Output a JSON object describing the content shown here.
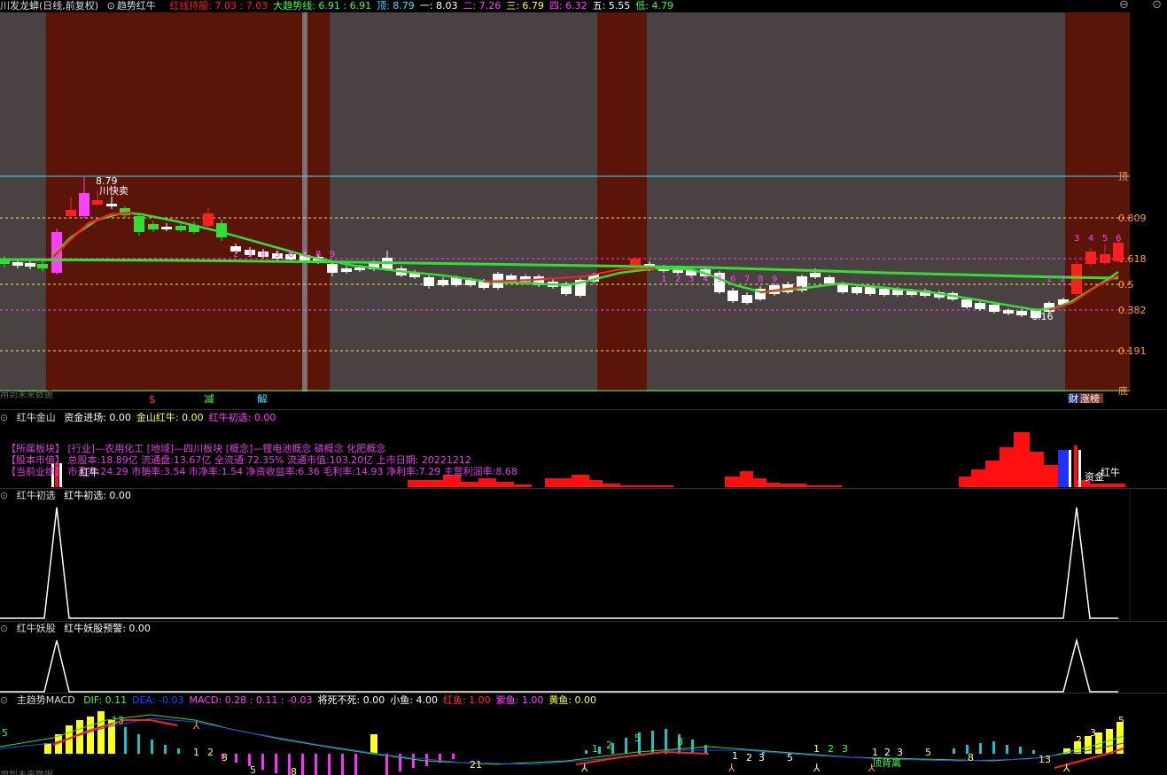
{
  "main": {
    "title": "川发龙蟒(日线,前复权)",
    "indicator_name": "趋势红牛",
    "items": [
      {
        "label": "红线持股: 7.03 : 7.03",
        "color": "#ff2020"
      },
      {
        "label": "大趋势线: 6.91 : 6.91",
        "color": "#40ff40"
      },
      {
        "label": "顶: 8.79",
        "color": "#40e0ff"
      },
      {
        "label": "一: 8.03",
        "color": "#ffffff"
      },
      {
        "label": "二: 7.26",
        "color": "#ff40ff"
      },
      {
        "label": "三: 6.79",
        "color": "#ffff40"
      },
      {
        "label": "四: 6.32",
        "color": "#ff40ff"
      },
      {
        "label": "五: 5.55",
        "color": "#ffffff"
      },
      {
        "label": "低: 4.79",
        "color": "#40ff40"
      }
    ],
    "levels": [
      {
        "label": "顶",
        "color": "#ff9a40"
      },
      {
        "label": "0.809",
        "color": "#ff9a40"
      },
      {
        "label": "0.618",
        "color": "#ff9a40"
      },
      {
        "label": "0.5",
        "color": "#ff9a40"
      },
      {
        "label": "0.382",
        "color": "#ff9a40"
      },
      {
        "label": "0.191",
        "color": "#ff9a40"
      },
      {
        "label": "底",
        "color": "#ff9a40"
      }
    ],
    "high_label": "8.79",
    "high_tag": "川快卖",
    "low_label": "6.16",
    "bottom_note": "用到未来数据",
    "signals": [
      {
        "text": "$",
        "color": "#ff3030"
      },
      {
        "text": "减",
        "color": "#40ff40"
      },
      {
        "text": "解",
        "color": "#40e0ff"
      }
    ],
    "tag_caizhang": "财",
    "tag_zhangting": "涨榜"
  },
  "pane2": {
    "title": "红牛金山",
    "items": [
      {
        "label": "资金进场: 0.00",
        "color": "#ffffff"
      },
      {
        "label": "金山红牛: 0.00",
        "color": "#ffff40"
      },
      {
        "label": "红牛初选: 0.00",
        "color": "#ff40ff"
      }
    ],
    "info_lines": [
      "【所属板块】 [行业]—农用化工 [地域]—四川板块 [概念]—锂电池概念 磷概念 化肥概念",
      "【股本市值】 总股本:18.89亿 流通盘:13.67亿 全流通:72.35% 流通市值:103.20亿 上市日期: 20221212",
      "【当前业绩】 市盈率:24.29 市销率:3.54 市净率:1.54 净资收益率:6.36 毛利率:14.93 净利率:7.29 主营利润率:8.68"
    ],
    "tag_hongniu_left": "红牛",
    "tag_hongniu_right": "红牛",
    "tag_zijin": "资金"
  },
  "pane3": {
    "title": "红牛初选",
    "items": [
      {
        "label": "红牛初选: 0.00",
        "color": "#ffffff"
      }
    ]
  },
  "pane4": {
    "title": "红牛妖股",
    "items": [
      {
        "label": "红牛妖股预警: 0.00",
        "color": "#ffffff"
      }
    ]
  },
  "pane5": {
    "title": "主趋势MACD",
    "items": [
      {
        "label": "DIF: 0.11",
        "color": "#40ff40"
      },
      {
        "label": "DEA: -0.03",
        "color": "#3040ff"
      },
      {
        "label": "MACD: 0.28 : 0.11 : -0.03",
        "color": "#ff40ff"
      },
      {
        "label": "将死不死: 0.00",
        "color": "#ffffff"
      },
      {
        "label": "小鱼: 4.00",
        "color": "#ffffff"
      },
      {
        "label": "红鱼: 1.00",
        "color": "#ff3030"
      },
      {
        "label": "紫鱼: 1.00",
        "color": "#ff40ff"
      },
      {
        "label": "黄鱼: 0.00",
        "color": "#ffff40"
      }
    ],
    "note_dinhao": "顶背离",
    "bottom_note": "用到未来数据"
  }
}
